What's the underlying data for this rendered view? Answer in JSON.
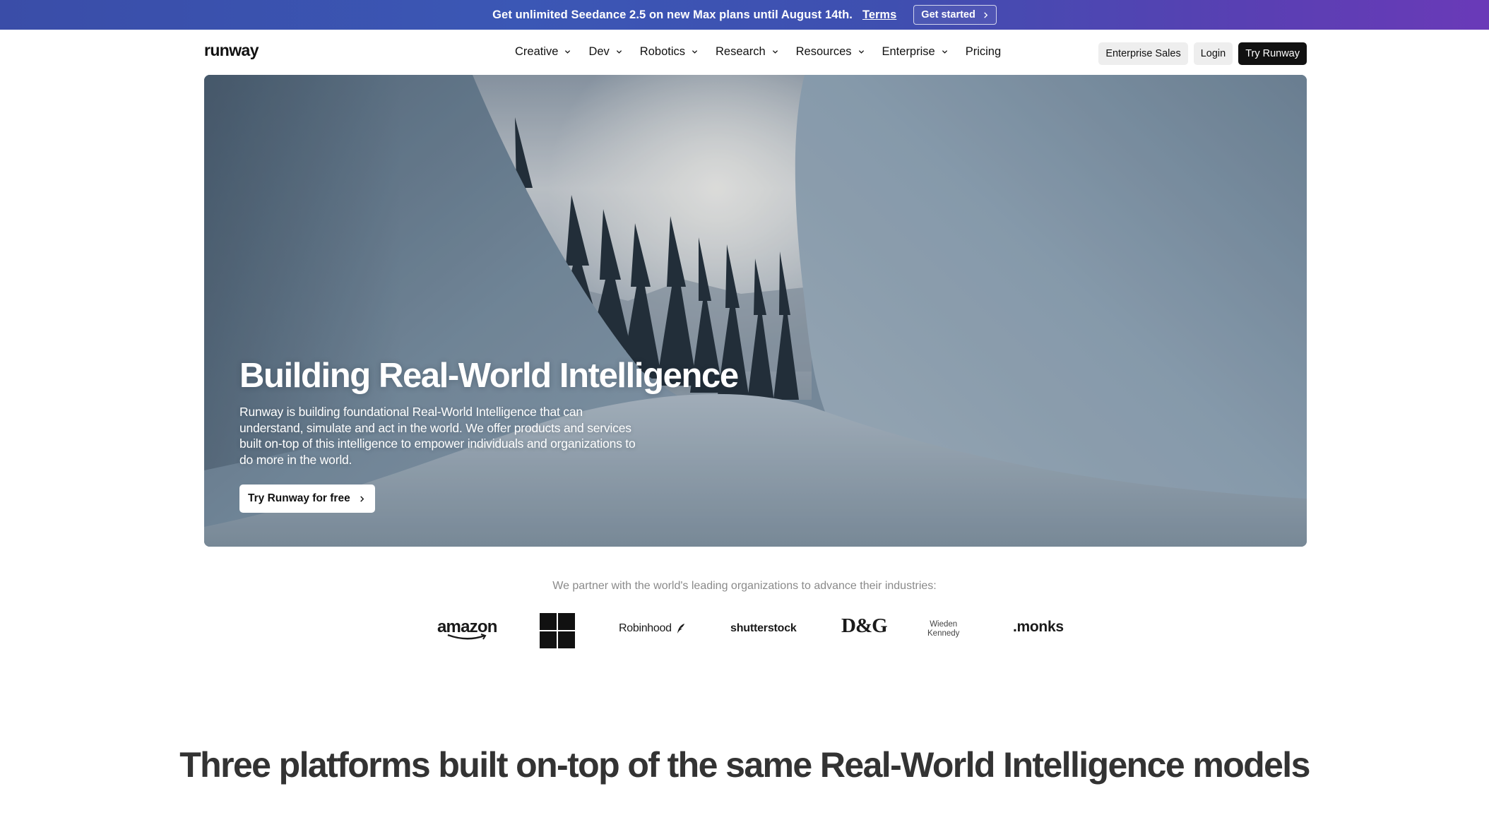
{
  "promo": {
    "text": "Get unlimited Seedance 2.5 on new Max plans until August 14th.",
    "link": "Terms",
    "button": "Get started"
  },
  "nav": {
    "logo": "runway",
    "items": [
      {
        "label": "Creative",
        "dropdown": true
      },
      {
        "label": "Dev",
        "dropdown": true
      },
      {
        "label": "Robotics",
        "dropdown": true
      },
      {
        "label": "Research",
        "dropdown": true
      },
      {
        "label": "Resources",
        "dropdown": true
      },
      {
        "label": "Enterprise",
        "dropdown": true
      },
      {
        "label": "Pricing",
        "dropdown": false
      }
    ],
    "enterprise_sales": "Enterprise Sales",
    "login": "Login",
    "try_runway": "Try Runway"
  },
  "hero": {
    "title": "Building Real-World Intelligence",
    "description": "Runway is building foundational Real-World Intelligence that can understand, simulate and act in the world. We offer products and services built on-top of this intelligence to empower individuals and organizations to do more in the world.",
    "cta": "Try Runway for free"
  },
  "partners": {
    "text": "We partner with the world's leading organizations to advance their industries:",
    "logos": {
      "amazon": "amazon",
      "microsoft": "microsoft-logo",
      "robinhood": "Robinhood",
      "shutterstock": "shutterstock",
      "dg": "D&G",
      "wieden_line1": "Wieden",
      "wieden_line2": "Kennedy",
      "monks": ".monks"
    }
  },
  "platforms": {
    "title": "Three platforms built on-top of the same Real-World Intelligence models"
  },
  "colors": {
    "promo_start": "#3a4da8",
    "promo_end": "#6a3ab8",
    "dark": "#111111",
    "muted": "#8a8a8a"
  },
  "icons": {
    "chevron": "chevron-down-icon",
    "arrow": "chevron-right-icon",
    "feather": "feather-icon"
  }
}
